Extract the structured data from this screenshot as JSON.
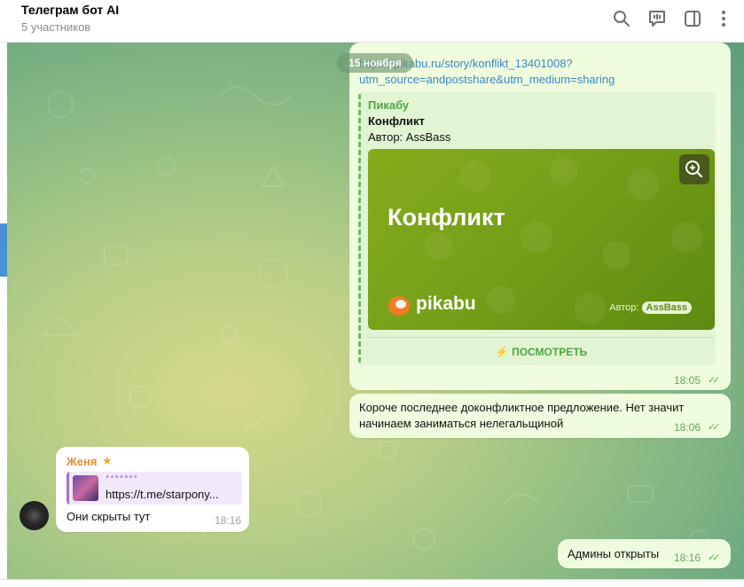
{
  "header": {
    "title": "Телеграм бот AI",
    "subtitle": "5 участников",
    "icons": [
      "search-icon",
      "chat-icon",
      "sidebar-icon",
      "more-icon"
    ]
  },
  "colors": {
    "outgoing_bubble": "#effdde",
    "incoming_bubble": "#ffffff",
    "link": "#3a87c7",
    "accent_green": "#4ea444"
  },
  "date_separator": "15 ноября",
  "messages": {
    "m1": {
      "link_line1": "https://pikabu.ru/story/konflikt_13401008?",
      "link_line2": "utm_source=andpostshare&utm_medium=sharing",
      "preview": {
        "site": "Пикабу",
        "title": "Конфликт",
        "description": "Автор: AssBass",
        "image_title": "Конфликт",
        "logo_text": "pikabu",
        "image_author_label": "Автор:",
        "image_author_name": "AssBass",
        "button": "⚡ ПОСМОТРЕТЬ"
      },
      "time": "18:05",
      "ticks": "✓✓"
    },
    "m2": {
      "line1": "Короче последнее доконфликтное предложение. Нет значит",
      "line2": "начинаем заниматься нелегальщиной",
      "time": "18:06",
      "ticks": "✓✓"
    },
    "m3": {
      "sender": "Женя",
      "star": "★",
      "reply_name": "*******",
      "reply_text": "https://t.me/starpony...",
      "text": "Они скрыты тут",
      "time": "18:16"
    },
    "m4": {
      "text": "Админы открыты",
      "time": "18:16",
      "ticks": "✓✓"
    }
  }
}
